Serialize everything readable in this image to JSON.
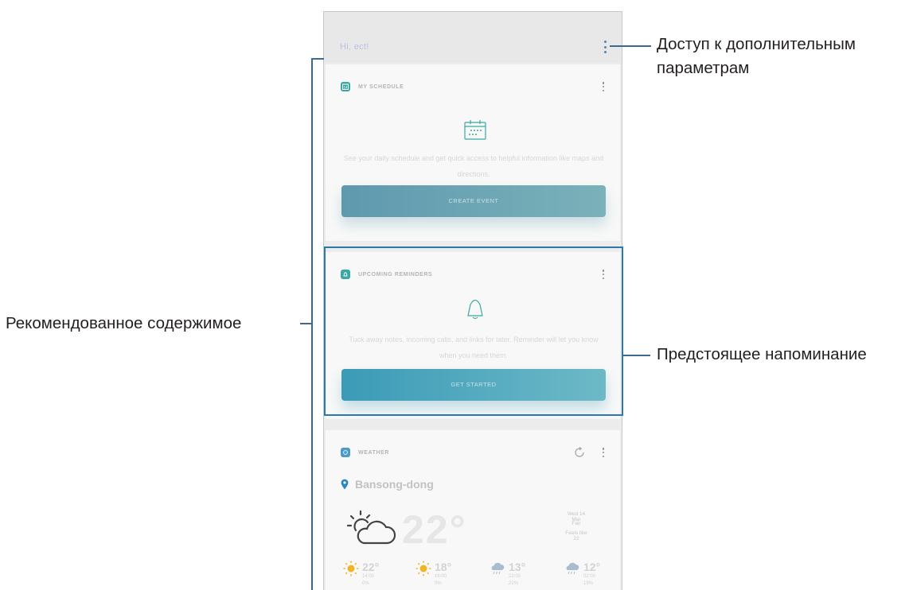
{
  "header": {
    "greeting": "Hi, ect!",
    "menu_icon": "kebab-menu-icon"
  },
  "cards": {
    "schedule": {
      "icon": "calendar-app-icon",
      "title": "MY SCHEDULE",
      "description": "See your daily schedule and get quick access to helpful information like maps and directions.",
      "button_label": "CREATE EVENT",
      "accent": "#3aa8a0"
    },
    "reminders": {
      "icon": "reminder-app-icon",
      "title": "UPCOMING REMINDERS",
      "description": "Tuck away notes, incoming calls, and links for later. Reminder will let you know when you need them.",
      "button_label": "GET STARTED",
      "accent": "#3aa8a0"
    },
    "weather": {
      "icon": "weather-app-icon",
      "title": "WEATHER",
      "location": "Bansong-dong",
      "current_temp": "22",
      "meta": [
        "Wed 14 Mar",
        "Fair",
        "Feels like 22"
      ],
      "forecast": [
        {
          "icon": "sun-icon",
          "temp": "22",
          "time": "14:00",
          "precip": "0%"
        },
        {
          "icon": "sun-icon",
          "temp": "18",
          "time": "16:00",
          "precip": "0%"
        },
        {
          "icon": "rain-icon",
          "temp": "13",
          "time": "22:00",
          "precip": "22%"
        },
        {
          "icon": "rain-icon",
          "temp": "12",
          "time": "02:00",
          "precip": "19%"
        }
      ]
    }
  },
  "annotations": {
    "more_options": [
      "Доступ к дополнительным",
      "параметрам"
    ],
    "recommended": "Рекомендованное содержимое",
    "reminder": "Предстоящее напоминание"
  },
  "colors": {
    "leader_line": "#3a6a92",
    "highlight": "#2b78ab"
  }
}
